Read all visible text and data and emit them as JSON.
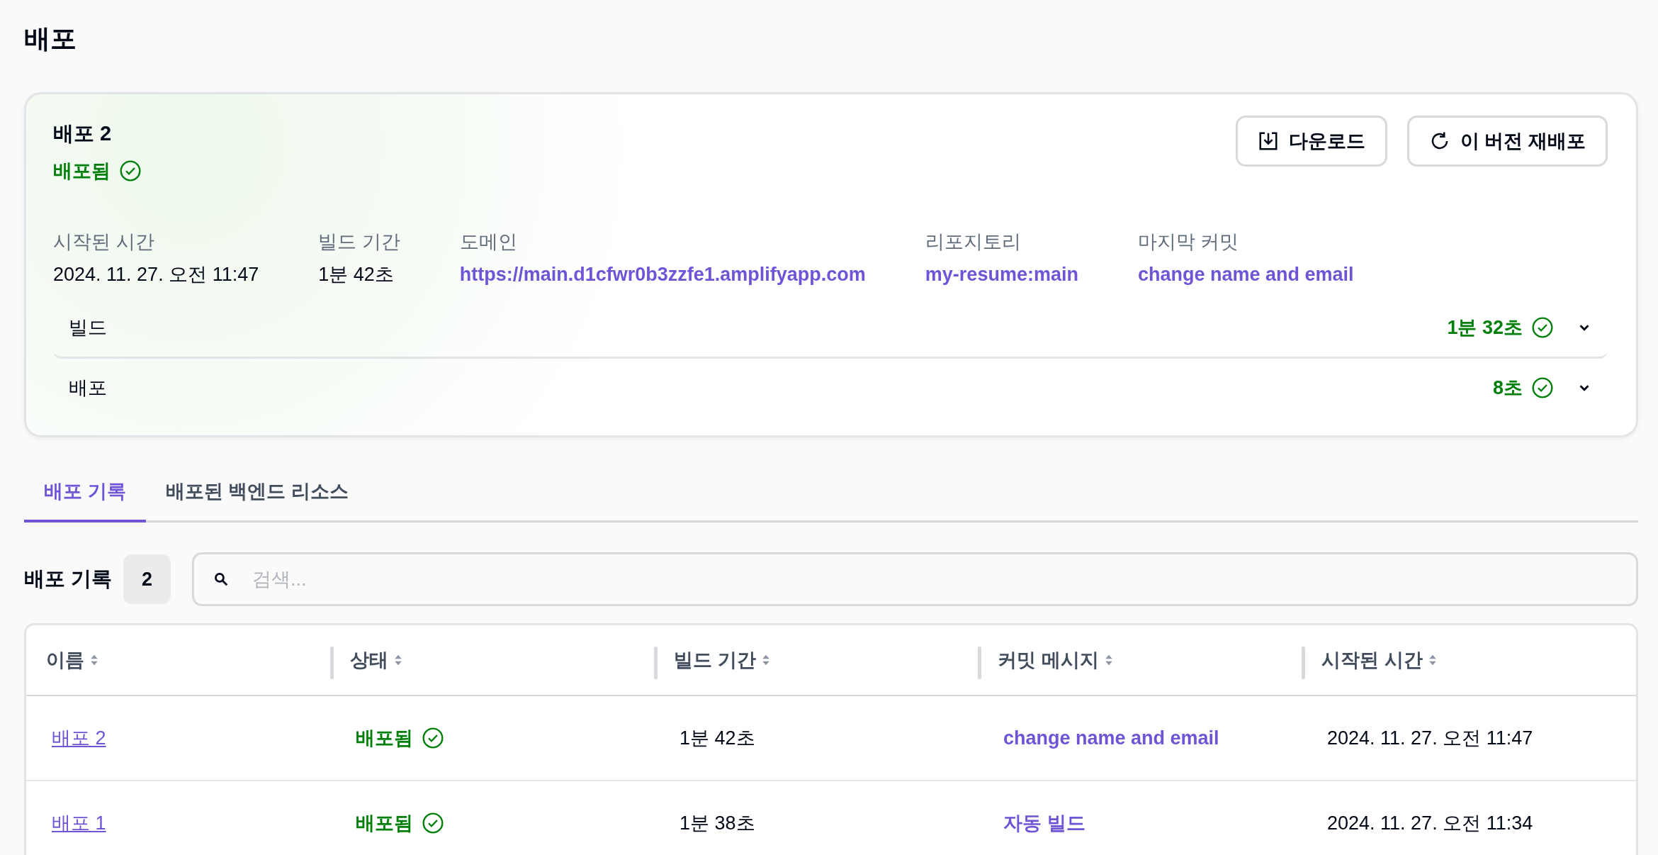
{
  "page_title": "배포",
  "deployment": {
    "title": "배포 2",
    "status": {
      "label": "배포됨",
      "kind": "success"
    },
    "buttons": [
      {
        "label": "다운로드"
      },
      {
        "label": "이 버전 재배포"
      }
    ],
    "details": [
      {
        "label": "시작된 시간",
        "value": "2024. 11. 27. 오전 11:47",
        "link": false
      },
      {
        "label": "빌드 기간",
        "value": "1분 42초",
        "link": false
      },
      {
        "label": "도메인",
        "value": "https://main.d1cfwr0b3zzfe1.amplifyapp.com",
        "link": true
      },
      {
        "label": "리포지토리",
        "value": "my-resume:main",
        "link": true
      },
      {
        "label": "마지막 커밋",
        "value": "change name and email",
        "link": true
      }
    ],
    "stages": [
      {
        "name": "빌드",
        "duration": "1분 32초",
        "kind": "success",
        "expanded": false
      },
      {
        "name": "배포",
        "duration": "8초",
        "kind": "success",
        "expanded": false
      }
    ]
  },
  "tabs": [
    {
      "label": "배포 기록",
      "selected": true
    },
    {
      "label": "배포된 백엔드 리소스",
      "selected": false
    }
  ],
  "history": {
    "title": "배포 기록",
    "count": "2",
    "search": {
      "placeholder": "검색..."
    },
    "columns": [
      "이름",
      "상태",
      "빌드 기간",
      "커밋 메시지",
      "시작된 시간"
    ],
    "rows": [
      {
        "name": "배포 2",
        "status": {
          "label": "배포됨",
          "kind": "success"
        },
        "duration": "1분 42초",
        "commit": "change name and email",
        "started": "2024. 11. 27. 오전 11:47"
      },
      {
        "name": "배포 1",
        "status": {
          "label": "배포됨",
          "kind": "success"
        },
        "duration": "1분 38초",
        "commit": "자동 빌드",
        "started": "2024. 11. 27. 오전 11:34"
      }
    ]
  }
}
